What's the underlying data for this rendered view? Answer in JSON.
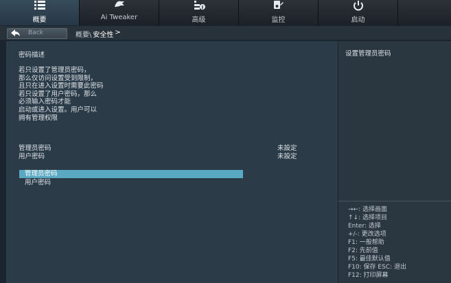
{
  "tabs": [
    {
      "label": "概要",
      "icon": "list-icon",
      "active": true
    },
    {
      "label": "Ai Tweaker",
      "icon": "tweaker-icon",
      "active": false
    },
    {
      "label": "高级",
      "icon": "advanced-icon",
      "active": false
    },
    {
      "label": "监控",
      "icon": "monitor-icon",
      "active": false
    },
    {
      "label": "启动",
      "icon": "power-icon",
      "active": false
    }
  ],
  "breadcrumb": {
    "back_label": "Back",
    "parent": "概要\\",
    "current": "安全性",
    "separator": ">"
  },
  "main": {
    "heading": "密码描述",
    "description": [
      "若只设置了管理员密码，",
      "那么仅访问设置受到限制，",
      "且只在进入设置时需要此密码",
      "若只设置了用户密码，那么",
      "必须输入密码才能",
      "启动或进入设置。用户可以",
      "拥有管理权限"
    ],
    "status": [
      {
        "label": "管理员密码",
        "value": "未設定"
      },
      {
        "label": "用户密码",
        "value": "未設定"
      }
    ],
    "menu": [
      {
        "label": "管理员密码",
        "selected": true
      },
      {
        "label": "用户密码",
        "selected": false
      }
    ]
  },
  "help": {
    "title": "设置管理员密码",
    "keys": [
      "→←: 选择画面",
      "↑↓: 选择项目",
      "Enter: 选择",
      "+/-: 更改选项",
      "F1: 一般帮助",
      "F2: 先前值",
      "F5: 最佳默认值",
      "F10: 保存  ESC: 退出",
      "F12: 打印屏幕"
    ]
  },
  "colors": {
    "background": "#1a2530",
    "panel": "#2c3b48",
    "selected": "#5aa9c3"
  }
}
